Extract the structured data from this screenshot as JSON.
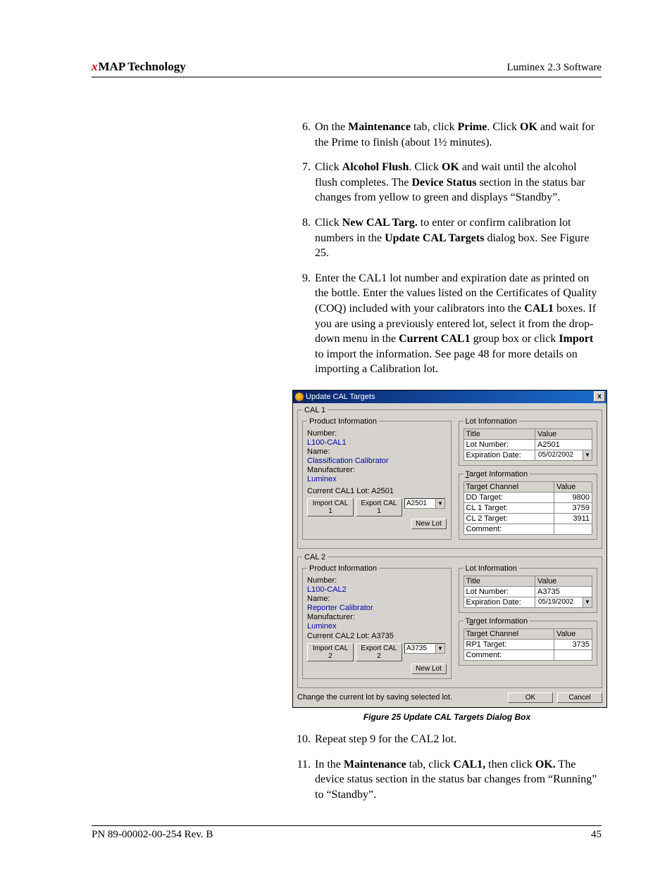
{
  "header": {
    "prefix": "x",
    "brand": "MAP Technology",
    "right": "Luminex 2.3 Software"
  },
  "steps": {
    "s6": {
      "num": "6.",
      "p1": "On the ",
      "b1": "Maintenance",
      "p2": " tab, click ",
      "b2": "Prime",
      "p3": ". Click ",
      "b3": "OK",
      "p4": " and wait for the Prime to finish (about 1½ minutes)."
    },
    "s7": {
      "num": "7.",
      "p1": "Click ",
      "b1": "Alcohol Flush",
      "p2": ". Click ",
      "b2": "OK",
      "p3": " and wait until the alcohol flush completes. The ",
      "b3": "Device Status",
      "p4": " section in the status bar changes from yellow to green and displays “Standby”."
    },
    "s8": {
      "num": "8.",
      "p1": "Click ",
      "b1": "New CAL Targ.",
      "p2": " to enter or confirm calibration lot numbers in the ",
      "b2": "Update CAL Targets",
      "p3": " dialog box. See Figure 25."
    },
    "s9": {
      "num": "9.",
      "p1": "Enter the CAL1 lot number and expiration date as printed on the bottle. Enter the values listed on the Certificates of Quality (COQ) included with your calibrators into the ",
      "b1": "CAL1",
      "p2": " boxes. If you are using a previously entered lot, select it from the drop-down menu in the ",
      "b2": "Current CAL1",
      "p3": " group box or click ",
      "b3": "Import",
      "p4": " to import the information. See page 48 for more details on importing a Calibration lot."
    },
    "s10": {
      "num": "10.",
      "txt": "Repeat step 9 for the CAL2 lot."
    },
    "s11": {
      "num": "11.",
      "p1": "In the ",
      "b1": "Maintenance",
      "p2": " tab, click ",
      "b2": "CAL1,",
      "p3": " then click ",
      "b3": "OK.",
      "p4": " The device status section in the status bar changes from “Running” to “Standby”."
    }
  },
  "dialog": {
    "title": "Update CAL Targets",
    "close": "x",
    "cal1": {
      "legend": "CAL 1",
      "prod": {
        "legend": "Product Information",
        "number_label": "Number:",
        "number_value": "L100-CAL1",
        "name_label": "Name:",
        "name_value": "Classification Calibrator",
        "mfr_label": "Manufacturer:",
        "mfr_value": "Luminex",
        "current_lot_label": "Current CAL1 Lot:  A2501",
        "dropdown_value": "A2501",
        "btn_import": "Import CAL 1",
        "btn_export": "Export CAL 1",
        "btn_new": "New Lot"
      },
      "lot": {
        "legend": "Lot Information",
        "hdr_title": "Title",
        "hdr_value": "Value",
        "row1_label": "Lot Number:",
        "row1_value": "A2501",
        "row2_label": "Expiration Date:",
        "row2_value": "05/02/2002"
      },
      "target": {
        "legend": "Target Information",
        "hdr_channel": "Target Channel",
        "hdr_value": "Value",
        "r1_label": "DD Target:",
        "r1_value": "9800",
        "r2_label": "CL 1 Target:",
        "r2_value": "3759",
        "r3_label": "CL 2 Target:",
        "r3_value": "3911",
        "r4_label": "Comment:",
        "r4_value": ""
      }
    },
    "cal2": {
      "legend": "CAL 2",
      "prod": {
        "legend": "Product Information",
        "number_label": "Number:",
        "number_value": "L100-CAL2",
        "name_label": "Name:",
        "name_value": "Reporter Calibrator",
        "mfr_label": "Manufacturer:",
        "mfr_value": "Luminex",
        "current_lot_label": "Current CAL2 Lot:   A3735",
        "dropdown_value": "A3735",
        "btn_import": "Import CAL 2",
        "btn_export": "Export CAL 2",
        "btn_new": "New Lot"
      },
      "lot": {
        "legend": "Lot Information",
        "hdr_title": "Title",
        "hdr_value": "Value",
        "row1_label": "Lot Number:",
        "row1_value": "A3735",
        "row2_label": "Expiration Date:",
        "row2_value": "05/19/2002"
      },
      "target": {
        "legend": "Target Information",
        "hdr_channel": "Target Channel",
        "hdr_value": "Value",
        "r1_label": "RP1 Target:",
        "r1_value": "3735",
        "r2_label": "Comment:",
        "r2_value": ""
      }
    },
    "footer_text": "Change the current lot by saving selected lot.",
    "ok": "OK",
    "cancel": "Cancel"
  },
  "caption": "Figure 25   Update CAL Targets Dialog Box",
  "footer": {
    "left": "PN 89-00002-00-254 Rev. B",
    "right": "45"
  }
}
